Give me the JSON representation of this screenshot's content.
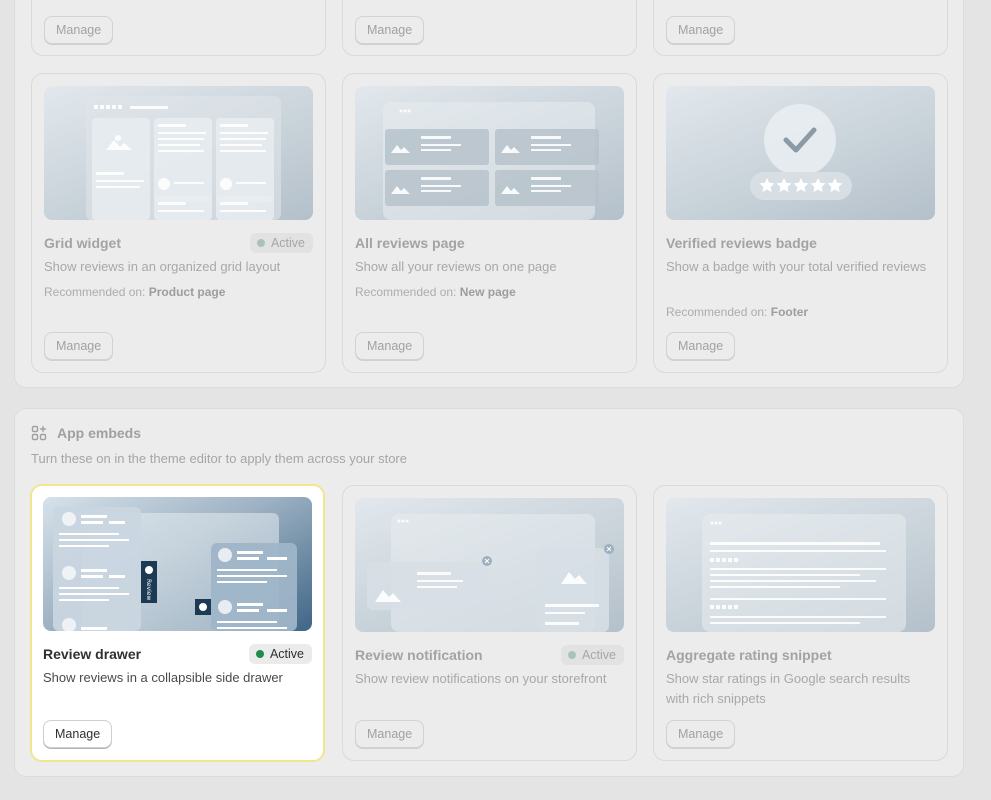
{
  "top_section": {
    "row1_buttons": [
      "Manage",
      "Manage",
      "Manage"
    ],
    "cards": [
      {
        "title": "Grid widget",
        "badge": "Active",
        "description": "Show reviews in an organized grid layout",
        "recommended_label": "Recommended on:",
        "recommended_value": "Product page",
        "button": "Manage"
      },
      {
        "title": "All reviews page",
        "description": "Show all your reviews on one page",
        "recommended_label": "Recommended on:",
        "recommended_value": "New page",
        "button": "Manage"
      },
      {
        "title": "Verified reviews badge",
        "description": "Show a badge with your total verified reviews",
        "recommended_label": "Recommended on:",
        "recommended_value": "Footer",
        "button": "Manage"
      }
    ]
  },
  "app_embeds": {
    "heading": "App embeds",
    "subtitle": "Turn these on in the theme editor to apply them across your store",
    "cards": [
      {
        "title": "Review drawer",
        "badge": "Active",
        "description": "Show reviews in a collapsible side drawer",
        "button": "Manage",
        "thumb_tab_label": "Review"
      },
      {
        "title": "Review notification",
        "badge": "Active",
        "description": "Show review notifications on your storefront",
        "button": "Manage"
      },
      {
        "title": "Aggregate rating snippet",
        "description": "Show star ratings in Google search results with rich snippets",
        "button": "Manage"
      }
    ]
  },
  "colors": {
    "active_dot": "#1f8a4c",
    "highlight_border": "#f1e68d",
    "page_bg": "#e4e4e4"
  }
}
